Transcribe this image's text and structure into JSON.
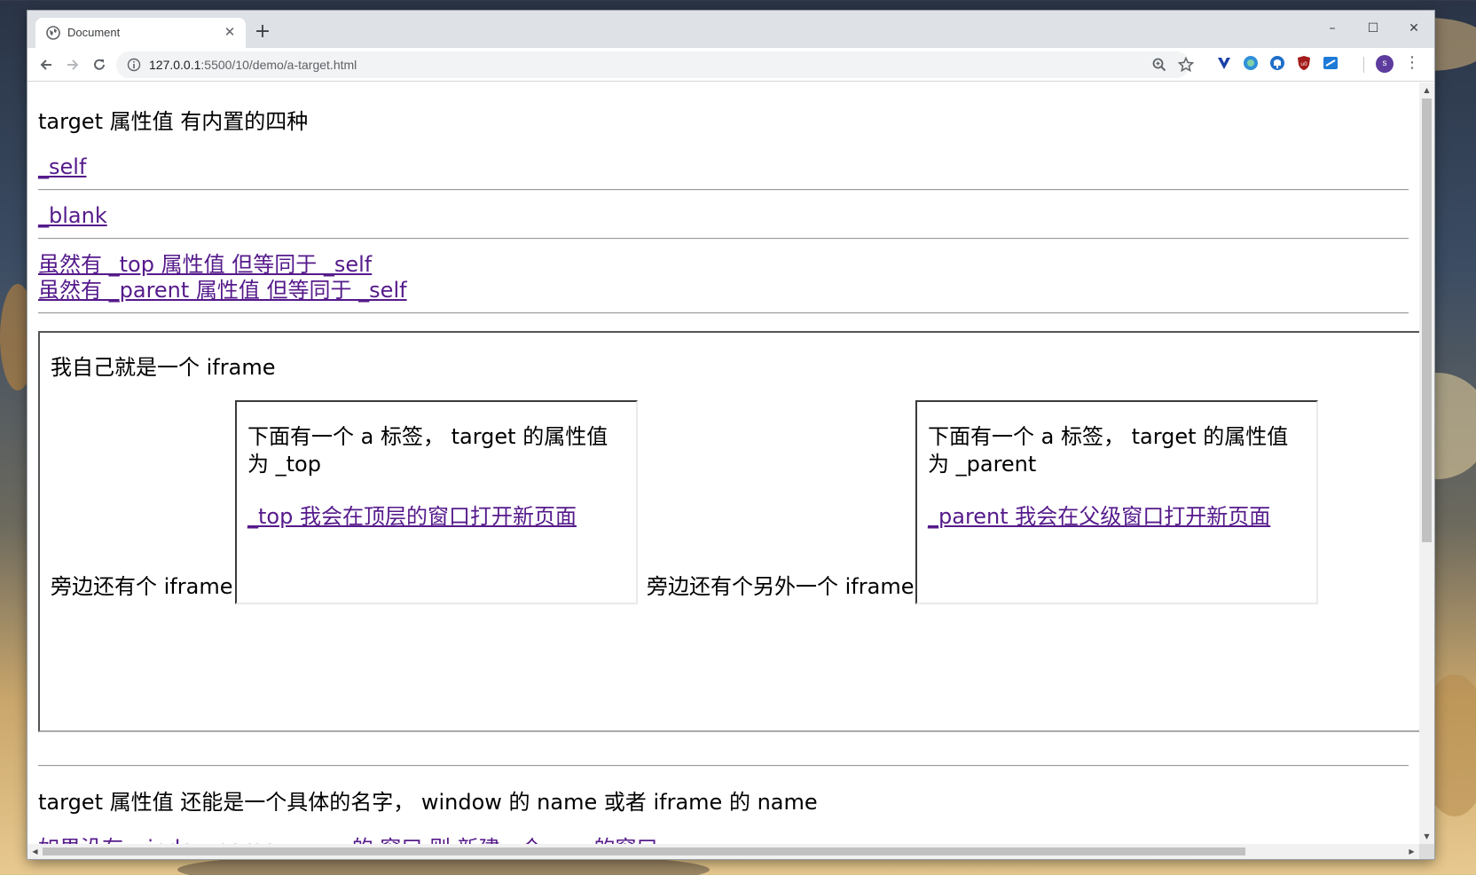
{
  "browser": {
    "tab_title": "Document",
    "tab_close": "✕",
    "new_tab": "+",
    "window_controls": {
      "minimize": "–",
      "maximize": "☐",
      "close": "✕"
    },
    "url_host": "127.0.0.1",
    "url_rest": ":5500/10/demo/a-target.html",
    "icons": {
      "back": "arrow-left-icon",
      "forward": "arrow-right-icon",
      "reload": "reload-icon",
      "site_info": "info-icon",
      "zoom": "zoom-icon",
      "bookmark": "star-icon",
      "menu": "more-vert-icon"
    },
    "avatar_letter": "s"
  },
  "page": {
    "intro": "target 属性值 有内置的四种",
    "link_self": "_self",
    "link_blank": "_blank",
    "link_top": "虽然有 _top 属性值 但等同于 _self",
    "link_parent": "虽然有 _parent 属性值 但等同于 _self",
    "outer_iframe": {
      "title": "我自己就是一个 iframe",
      "left_label": "旁边还有个 iframe",
      "right_label": "旁边还有个另外一个 iframe",
      "frame_top": {
        "text": "下面有一个 a 标签， target 的属性值为 _top",
        "link": "_top 我会在顶层的窗口打开新页面"
      },
      "frame_parent": {
        "text": "下面有一个 a 标签， target 的属性值为 _parent",
        "link": "_parent 我会在父级窗口打开新页面"
      }
    },
    "outro": "target 属性值 还能是一个具体的名字， window 的 name 或者 iframe 的 name",
    "partial_link": "如果没有 window.name = xxx 的 窗口 则 新建一个 xxx 的窗口"
  },
  "colors": {
    "link_visited": "#551a8b",
    "tabstrip": "#dee1e6",
    "omnibox": "#f1f3f4",
    "avatar": "#5e3c9e"
  }
}
